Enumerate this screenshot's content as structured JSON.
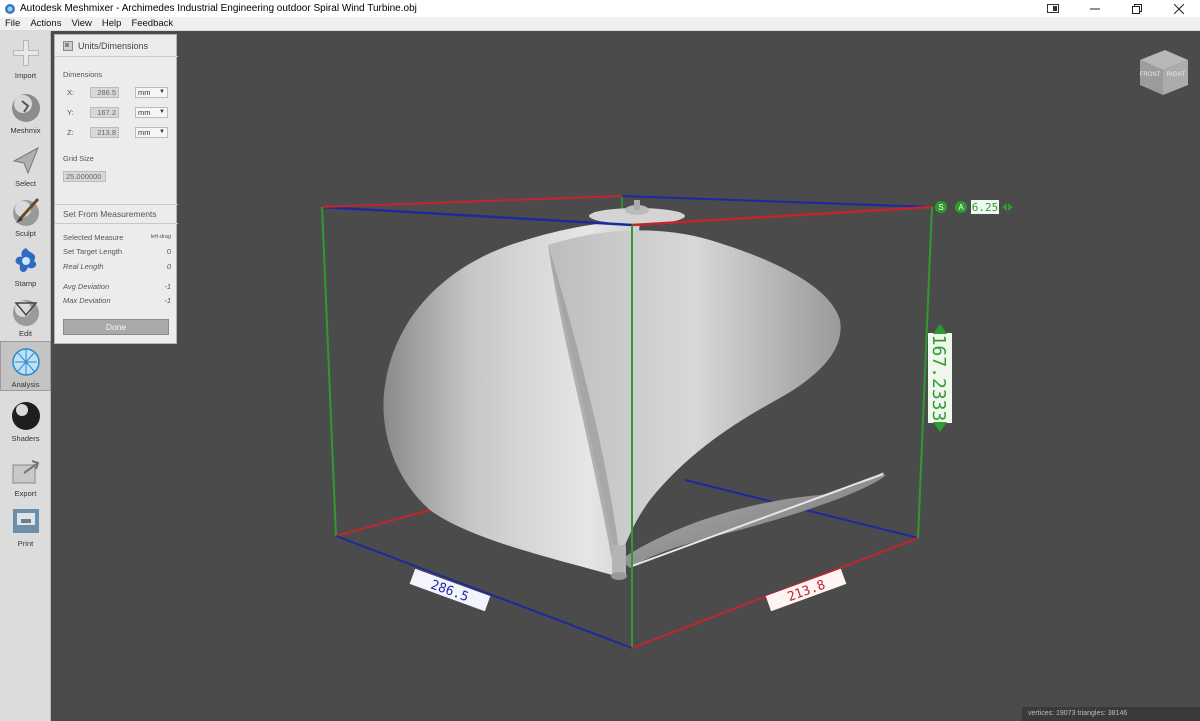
{
  "window": {
    "title": "Autodesk Meshmixer - Archimedes Industrial Engineering outdoor Spiral Wind Turbine.obj"
  },
  "menu": [
    "File",
    "Actions",
    "View",
    "Help",
    "Feedback"
  ],
  "toolbar": [
    {
      "label": "Import",
      "icon": "plus-icon"
    },
    {
      "label": "Meshmix",
      "icon": "meshmix-icon"
    },
    {
      "label": "Select",
      "icon": "select-arrow-icon"
    },
    {
      "label": "Sculpt",
      "icon": "sculpt-brush-icon"
    },
    {
      "label": "Stamp",
      "icon": "stamp-icon"
    },
    {
      "label": "Edit",
      "icon": "edit-icon"
    },
    {
      "label": "Analysis",
      "icon": "analysis-icon"
    },
    {
      "label": "Shaders",
      "icon": "shaders-sphere-icon"
    },
    {
      "label": "Export",
      "icon": "export-icon"
    },
    {
      "label": "Print",
      "icon": "print-icon"
    }
  ],
  "panel": {
    "title": "Units/Dimensions",
    "dimensions_label": "Dimensions",
    "x_label": "X:",
    "y_label": "Y:",
    "z_label": "Z:",
    "x_value": "286.5",
    "y_value": "167.2",
    "z_value": "213.8",
    "unit": "mm",
    "grid_size_label": "Grid Size",
    "grid_size_value": "25.000000",
    "set_from_measurements": "Set From Measurements",
    "selected_measure_label": "Selected Measure",
    "selected_measure_value": "left-drag",
    "set_target_length_label": "Set Target Length",
    "set_target_length_value": "0",
    "real_length_label": "Real Length",
    "real_length_value": "0",
    "avg_deviation_label": "Avg Deviation",
    "avg_deviation_value": "-1",
    "max_deviation_label": "Max Deviation",
    "max_deviation_value": "-1",
    "done_label": "Done"
  },
  "viewport": {
    "viewcube_front": "FRONT",
    "viewcube_right": "RIGHT",
    "height_label": "167.2333",
    "width_label": "213.8",
    "depth_label": "286.5",
    "scale_s": "S",
    "scale_a": "A",
    "scale_value": "6.25",
    "status": "vertices: 19073 triangles: 38146"
  },
  "colors": {
    "box_red": "#c0262c",
    "box_blue": "#1c2a9e",
    "box_green": "#2f9a2e",
    "background": "#4b4b4b"
  }
}
